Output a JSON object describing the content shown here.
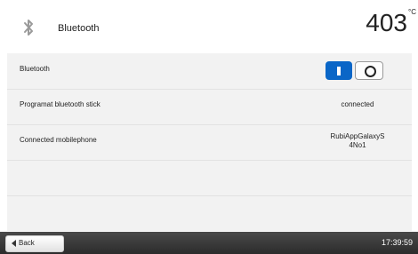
{
  "header": {
    "icon": "bluetooth-icon",
    "title": "Bluetooth",
    "temperature": "403",
    "unit": "°C",
    "sub": " "
  },
  "rows": [
    {
      "label": "Bluetooth",
      "toggle_on_label": "I",
      "toggle_off_label": "O"
    },
    {
      "label": "Programat bluetooth stick",
      "value": "connected"
    },
    {
      "label": "Connected mobilephone",
      "value_line1": "RubiAppGalaxyS",
      "value_line2": "4No1"
    }
  ],
  "footer": {
    "back_label": "Back",
    "time": "17:39:59"
  },
  "colors": {
    "accent": "#0a66c7",
    "footer": "#333333",
    "panel": "#f2f2f2"
  }
}
